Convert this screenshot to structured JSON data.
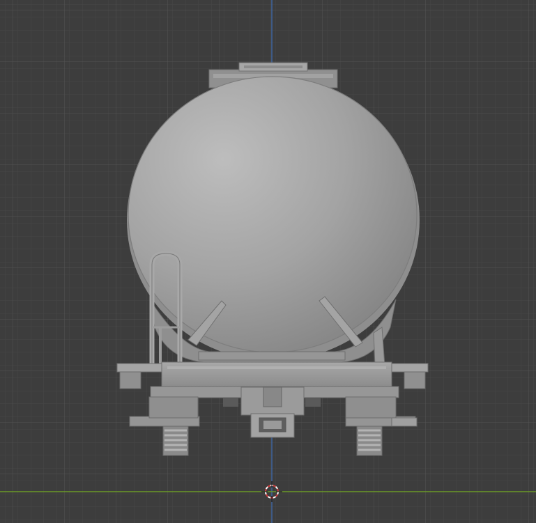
{
  "viewport": {
    "view": "front-orthographic",
    "background_color": "#3d3d3d",
    "grid_minor_color": "#474747",
    "grid_major_color": "#555555",
    "x_axis_color": "#6b9a27",
    "z_axis_color": "#3f6fb5",
    "model_color": "#9a9a9a",
    "cursor_colors": [
      "#d23c3c",
      "#ffffff"
    ]
  },
  "scene": {
    "object": "tank-wagon-model",
    "icons": [
      "3d-cursor-icon"
    ]
  }
}
